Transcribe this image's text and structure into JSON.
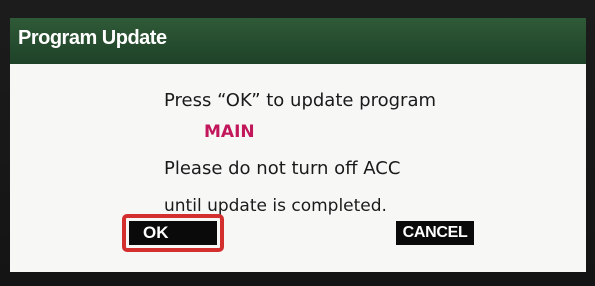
{
  "dialog": {
    "title": "Program Update",
    "message_line1": "Press “OK” to update program",
    "program_name": "MAIN",
    "message_line2": "Please do not turn off ACC",
    "message_line3": "until update is completed."
  },
  "buttons": {
    "ok_label": "OK",
    "cancel_label": "CANCEL"
  },
  "colors": {
    "title_bar": "#2f5a37",
    "program_name": "#c2185b",
    "highlight": "#d32f2f"
  }
}
